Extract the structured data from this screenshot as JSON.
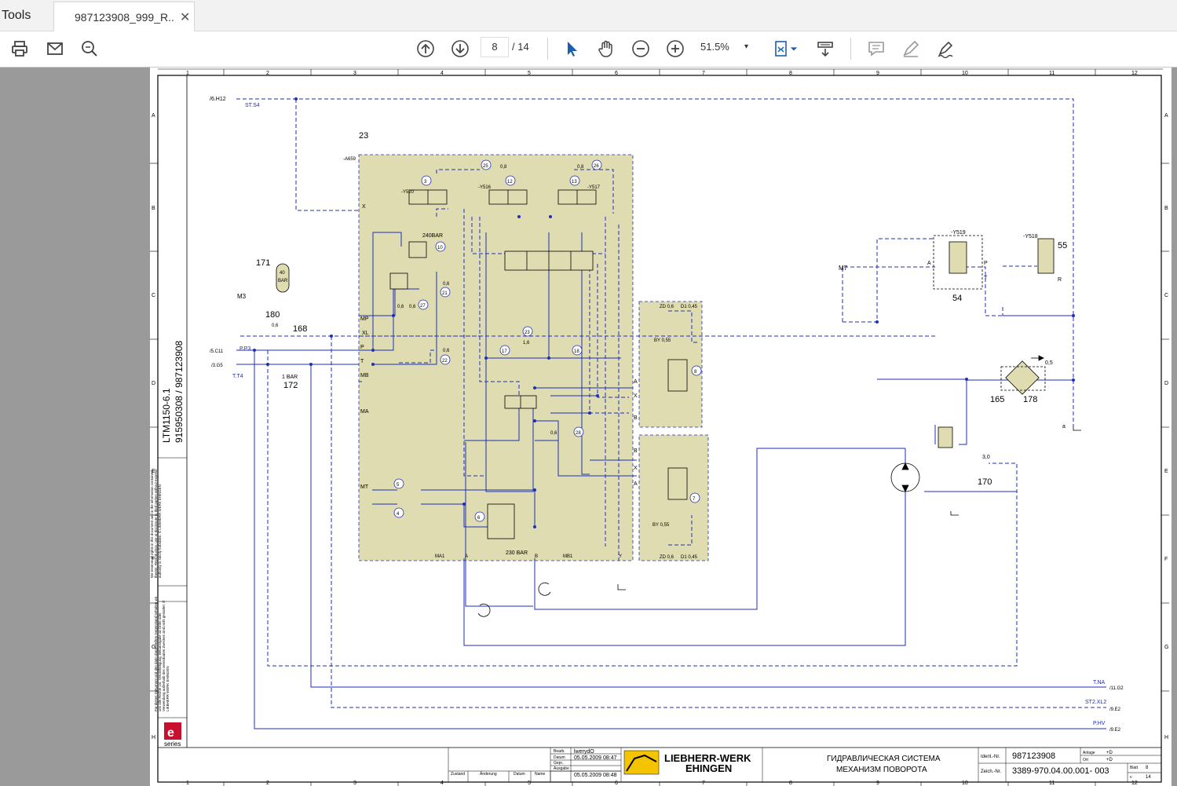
{
  "tabs": {
    "tools_label": "Tools",
    "document_tab_title": "987123908_999_R...",
    "close_glyph": "✕"
  },
  "toolbar": {
    "print_icon": "print-icon",
    "email_icon": "email-icon",
    "search_icon": "search-zoom-icon",
    "current_page": "8",
    "total_pages": "/ 14",
    "zoom_level": "51.5%",
    "zoom_arrow": "▾"
  },
  "colors": {
    "accent": "#1a5fb4",
    "schematic_line": "#1f2fb8",
    "fill": "#dedcb0"
  },
  "drawing": {
    "col_labels": [
      "1",
      "2",
      "3",
      "4",
      "5",
      "6",
      "7",
      "8",
      "9",
      "10",
      "11",
      "12"
    ],
    "row_labels": [
      "A",
      "B",
      "C",
      "D",
      "E",
      "F",
      "G",
      "H"
    ],
    "side_model": "LTM1150-6.1",
    "side_number": "915950308  /  987123908",
    "series_label": "series",
    "labels": {
      "ref_6h12": "/6.H12",
      "st_s4": "ST.S4",
      "n23": "23",
      "a659": "-A659",
      "y520": "-Y520",
      "y516": "-Y516",
      "y517": "-Y517",
      "n3": "3",
      "n12": "12",
      "n13": "13",
      "n25": "25",
      "n26": "26",
      "v08a": "0,8",
      "v08b": "0,8",
      "x_port": "X",
      "bar240": "240BAR",
      "n10": "10",
      "n171": "171",
      "bar40a": "40",
      "bar40b": "BAR",
      "m3": "M3",
      "n180": "180",
      "v06": "0,6",
      "n168": "168",
      "ref_5c11": "/5.C11",
      "pp3": "P.P3",
      "ref_3g5": "/3.G5",
      "tt4": "T.T4",
      "bar1": "1 BAR",
      "n172": "172",
      "mp": "MP",
      "xl": "XL",
      "p": "P",
      "t": "T",
      "mb": "MB",
      "ma": "MA",
      "mt": "MT",
      "n21": "21",
      "n22": "22",
      "n27": "27",
      "n23c": "23",
      "n17": "17",
      "n18": "18",
      "v06b": "0,6",
      "v06c": "0,6",
      "v06d": "0,6",
      "v06e": "0,6",
      "v16": "1,6",
      "n28": "28",
      "v06f": "0,6",
      "n5": "5",
      "n4": "4",
      "n6": "6",
      "bar230": "230 BAR",
      "ma1": "MA1",
      "a_port": "A",
      "b_port": "B",
      "mb1": "MB1",
      "y_port": "Y",
      "zd06": "ZD 0,6",
      "d1045": "D1 0,45",
      "by055": "BY 0,55",
      "n8": "8",
      "n7": "7",
      "zd06b": "ZD 0,6",
      "d1045b": "D1 0,45",
      "by055b": "BY 0,55",
      "m7": "M7",
      "y519": "-Y519",
      "y518": "-Y518",
      "n55": "55",
      "n54": "54",
      "n165": "165",
      "n178": "178",
      "v05": "0,5",
      "v30": "3,0",
      "n170": "170",
      "a_small": "a",
      "tna": "T.NA",
      "ref_11g2": "/11.G2",
      "st2xl2": "ST2.XL2",
      "ref_9e2": "/9.E2",
      "phv": "P.HV",
      "ref_9e2b": "/9.E2",
      "port_A": "A",
      "port_P": "P",
      "port_T": "T",
      "port_R": "R",
      "port_A2": "A",
      "port_B": "B",
      "port_X": "X",
      "port_A3": "A",
      "port_B2": "B",
      "port_X2": "X"
    },
    "legal_text_1": "We reserve all rights in this document and in the information contained therein. Reproduction, use or disclosure to third parties without express authority is strictly forbidden. © LIEBHERR WERK EHINGEN",
    "legal_text_2": "Für dieses Dokument und den darin dargestellten Gegenstand behalten wir uns alle Rechte vor. Vervielfältigung, Bekanntgabe an Dritte oder Verwendung außerhalb des vereinbarten Zweckes sind nicht gestattet. © LIEBHERR WERK EHINGEN"
  },
  "title_block": {
    "bearb_label": "Bearb.",
    "bearb_value": "lwerydO",
    "datum_label": "Datum",
    "datum_value_1": "05.05.2009  08:47",
    "gepr_label": "Gepr.",
    "ausgabe_label": "Ausgabe",
    "datum_value_2": "05.05.2009  08:48",
    "zustand": "Zustand",
    "anderung": "Änderung",
    "datum2": "Datum",
    "name": "Name",
    "company_1": "LIEBHERR-WERK",
    "company_2": "EHINGEN",
    "title_ru_1": "ГИДРАВЛИЧЕСКАЯ СИСТЕМА",
    "title_ru_2": "МЕХАНИЗМ ПОВОРОТА",
    "ident_label": "Ident.-Nr.",
    "ident_value": "987123908",
    "zeich_label": "Zeich.-Nr.",
    "zeich_value": "3389-970.04.00.001- 003",
    "anlage_label": "Anlage",
    "anlage_value": "+D",
    "ort_label": "Ort",
    "ort_value": "+D",
    "blatt_label": "Blatt",
    "blatt_value": "8",
    "von_label": "v",
    "von_value": "14"
  }
}
